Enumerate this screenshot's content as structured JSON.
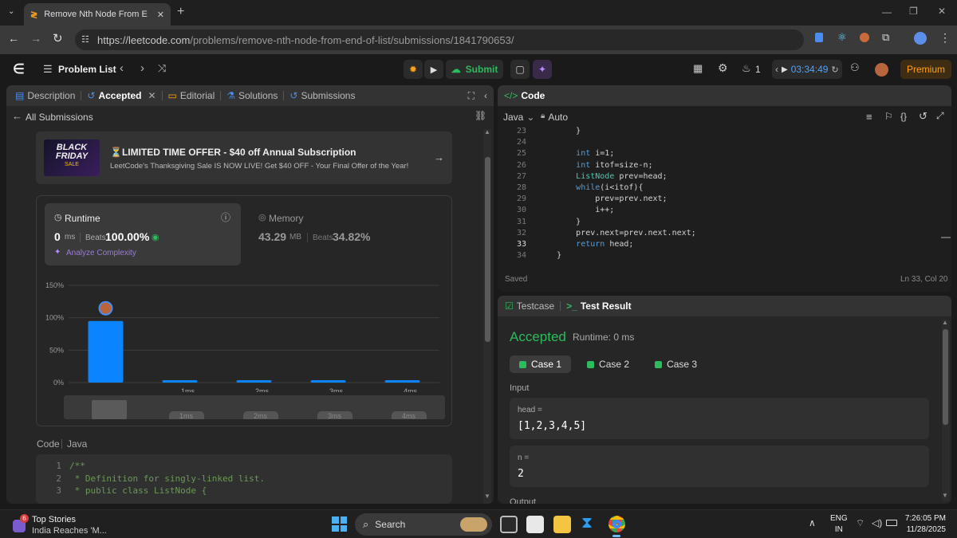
{
  "browser": {
    "tab_title": "Remove Nth Node From End of",
    "url_host": "https://leetcode.com",
    "url_path": "/problems/remove-nth-node-from-end-of-list/submissions/1841790653/"
  },
  "nav": {
    "problem_list": "Problem List",
    "submit": "Submit",
    "streak": "1",
    "timer": "03:34:49",
    "premium": "Premium"
  },
  "left_tabs": [
    {
      "label": "Description"
    },
    {
      "label": "Accepted"
    },
    {
      "label": "Editorial"
    },
    {
      "label": "Solutions"
    },
    {
      "label": "Submissions"
    }
  ],
  "all_submissions": "All Submissions",
  "promo": {
    "badge_line1": "BLACK",
    "badge_line2": "FRIDAY",
    "badge_line3": "SALE",
    "title": "⏳LIMITED TIME OFFER - $40 off Annual Subscription",
    "subtitle": "LeetCode's Thanksgiving Sale IS NOW LIVE! Get $40 OFF - Your Final Offer of the Year!"
  },
  "runtime": {
    "label": "Runtime",
    "value": "0",
    "unit": "ms",
    "beats_label": "Beats",
    "beats": "100.00%",
    "analyze": "Analyze Complexity"
  },
  "memory": {
    "label": "Memory",
    "value": "43.29",
    "unit": "MB",
    "beats_label": "Beats",
    "beats": "34.82%"
  },
  "chart_data": {
    "type": "bar",
    "categories": [
      "",
      "1ms",
      "2ms",
      "3ms",
      "4ms"
    ],
    "values": [
      95,
      3,
      3,
      3,
      3
    ],
    "y_ticks": [
      "150%",
      "100%",
      "50%",
      "0%"
    ],
    "ylim": [
      0,
      150
    ],
    "grid": true,
    "color": "#0a84ff",
    "mini_labels": [
      "1ms",
      "2ms",
      "3ms",
      "4ms"
    ]
  },
  "code_section": {
    "label": "Code",
    "lang": "Java",
    "lines": [
      {
        "n": "1",
        "text": "/**"
      },
      {
        "n": "2",
        "text": " * Definition for singly-linked list."
      },
      {
        "n": "3",
        "text": " * public class ListNode {"
      }
    ]
  },
  "editor": {
    "title": "Code",
    "lang": "Java",
    "mode": "Auto",
    "lines": [
      {
        "n": "23",
        "text": "        }"
      },
      {
        "n": "24",
        "text": ""
      },
      {
        "n": "25",
        "text": "        int i=1;"
      },
      {
        "n": "26",
        "text": "        int itof=size-n;"
      },
      {
        "n": "27",
        "text": "        ListNode prev=head;"
      },
      {
        "n": "28",
        "text": "        while(i<itof){"
      },
      {
        "n": "29",
        "text": "            prev=prev.next;"
      },
      {
        "n": "30",
        "text": "            i++;"
      },
      {
        "n": "31",
        "text": "        }"
      },
      {
        "n": "32",
        "text": "        prev.next=prev.next.next;"
      },
      {
        "n": "33",
        "text": "        return head;"
      },
      {
        "n": "34",
        "text": "    }"
      }
    ],
    "saved": "Saved",
    "position": "Ln 33, Col 20"
  },
  "result": {
    "tab_testcase": "Testcase",
    "tab_result": "Test Result",
    "status": "Accepted",
    "runtime": "Runtime: 0 ms",
    "cases": [
      "Case 1",
      "Case 2",
      "Case 3"
    ],
    "input_label": "Input",
    "head_label": "head =",
    "head_value": "[1,2,3,4,5]",
    "n_label": "n =",
    "n_value": "2",
    "output_label": "Output"
  },
  "taskbar": {
    "news_title": "Top Stories",
    "news_sub": "India Reaches 'M...",
    "news_badge": "6",
    "search": "Search",
    "lang1": "ENG",
    "lang2": "IN",
    "time": "7:26:05 PM",
    "date": "11/28/2025"
  }
}
